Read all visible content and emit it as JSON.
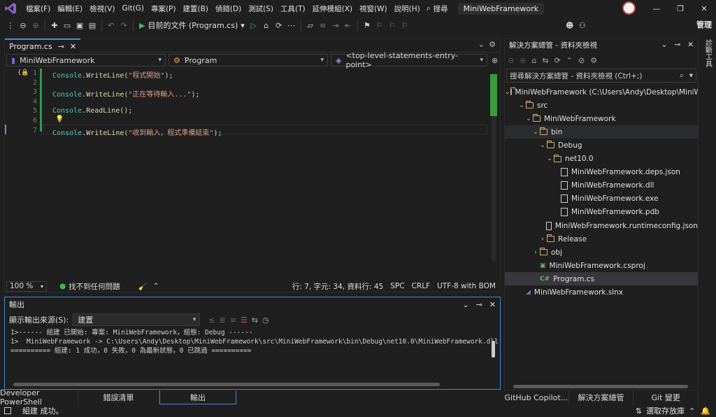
{
  "menu": [
    "檔案(F)",
    "編輯(E)",
    "檢視(V)",
    "Git(G)",
    "專案(P)",
    "建置(B)",
    "偵錯(D)",
    "測試(S)",
    "工具(T)",
    "延伸模組(X)",
    "視窗(W)",
    "說明(H)"
  ],
  "search_label": "搜尋",
  "solution_title": "MiniWebFramework",
  "manage_label": "管理",
  "run_target": "目前的文件 (Program.cs)",
  "editor": {
    "tab_title": "Program.cs",
    "nav_project": "MiniWebFramework",
    "nav_class": "Program",
    "nav_member": "<top-level-statements-entry-point>",
    "lines": [
      {
        "n": "1",
        "obj": "Console",
        "method": "WriteLine",
        "arg": "\"程式開始\""
      },
      {
        "n": "2"
      },
      {
        "n": "3",
        "obj": "Console",
        "method": "WriteLine",
        "arg": "\"正在等待輸入...\""
      },
      {
        "n": "4"
      },
      {
        "n": "5",
        "obj": "Console",
        "method": "ReadLine",
        "arg": ""
      },
      {
        "n": "6"
      },
      {
        "n": "7",
        "obj": "Console",
        "method": "WriteLine",
        "arg": "\"收到輸入，程式準備結束\""
      }
    ]
  },
  "status": {
    "zoom": "100 %",
    "issues": "找不到任何問題",
    "position": "行: 7, 字元: 34, 資料行: 45",
    "whitespace": "SPC",
    "line_ending": "CRLF",
    "encoding": "UTF-8 with BOM"
  },
  "output": {
    "title": "輸出",
    "source_label": "顯示輸出來源(S):",
    "source_value": "建置",
    "lines": [
      "1>------ 組建 已開始: 專案: MiniWebFramework，組態: Debug ------",
      "1>  MiniWebFramework -> C:\\Users\\Andy\\Desktop\\MiniWebFramework\\src\\MiniWebFramework\\bin\\Debug\\net10.0\\MiniWebFramework.dll",
      "========== 組建: 1 成功，0 失敗，0 為最新狀態，0 已跳過 =========="
    ]
  },
  "bottom_tabs": [
    "Developer PowerShell",
    "錯誤清單",
    "輸出"
  ],
  "solution_explorer": {
    "title": "解決方案總管 - 資料夾檢視",
    "search_placeholder": "搜尋解決方案總管 - 資料夾檢視 (Ctrl+;)",
    "tree": [
      {
        "label": "MiniWebFramework (C:\\Users\\Andy\\Desktop\\MiniWebFramework)",
        "depth": 0,
        "kind": "folder",
        "chev": "open"
      },
      {
        "label": "src",
        "depth": 1,
        "kind": "folder",
        "chev": "open"
      },
      {
        "label": "MiniWebFramework",
        "depth": 2,
        "kind": "folder",
        "chev": "open"
      },
      {
        "label": "bin",
        "depth": 3,
        "kind": "folder",
        "chev": "open",
        "state": "sel"
      },
      {
        "label": "Debug",
        "depth": 4,
        "kind": "folder",
        "chev": "open"
      },
      {
        "label": "net10.0",
        "depth": 5,
        "kind": "folder",
        "chev": "open"
      },
      {
        "label": "MiniWebFramework.deps.json",
        "depth": 6,
        "kind": "file"
      },
      {
        "label": "MiniWebFramework.dll",
        "depth": 6,
        "kind": "file"
      },
      {
        "label": "MiniWebFramework.exe",
        "depth": 6,
        "kind": "file"
      },
      {
        "label": "MiniWebFramework.pdb",
        "depth": 6,
        "kind": "file"
      },
      {
        "label": "MiniWebFramework.runtimeconfig.json",
        "depth": 6,
        "kind": "file"
      },
      {
        "label": "Release",
        "depth": 4,
        "kind": "folder",
        "chev": "closed"
      },
      {
        "label": "obj",
        "depth": 3,
        "kind": "folder",
        "chev": "closed"
      },
      {
        "label": "MiniWebFramework.csproj",
        "depth": 3,
        "kind": "csproj"
      },
      {
        "label": "Program.cs",
        "depth": 3,
        "kind": "cs",
        "state": "cur"
      },
      {
        "label": "MiniWebFramework.slnx",
        "depth": 1,
        "kind": "sln"
      }
    ]
  },
  "se_tabs": [
    "GitHub Copilot...",
    "解決方案總管",
    "Git 變更"
  ],
  "right_rail": "診斷工具",
  "bottom_status": "組建 成功。",
  "repo_label": "選取存放庫"
}
